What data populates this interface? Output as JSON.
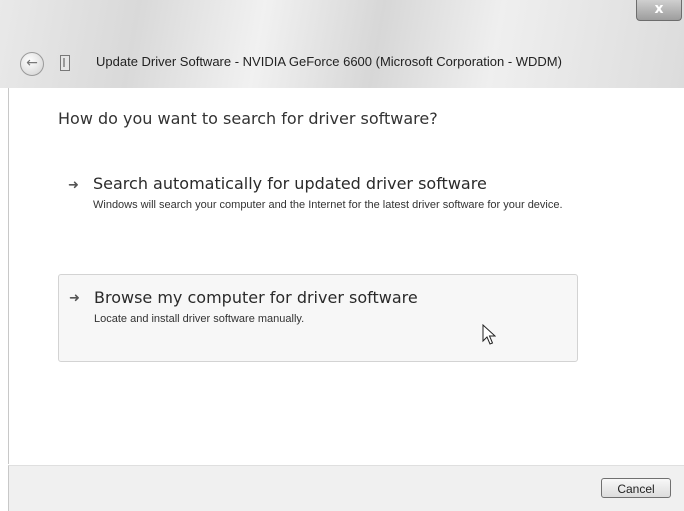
{
  "window": {
    "title": "Update Driver Software - NVIDIA GeForce 6600 (Microsoft Corporation - WDDM)",
    "close_label": "x"
  },
  "main": {
    "heading": "How do you want to search for driver software?",
    "options": [
      {
        "title": "Search automatically for updated driver software",
        "description": "Windows will search your computer and the Internet for the latest driver software for your device."
      },
      {
        "title": "Browse my computer for driver software",
        "description": "Locate and install driver software manually."
      }
    ]
  },
  "footer": {
    "cancel_label": "Cancel"
  },
  "icons": {
    "back": "back-arrow-icon",
    "device": "device-icon",
    "option_arrow": "right-arrow-icon",
    "cursor": "mouse-cursor-icon"
  }
}
